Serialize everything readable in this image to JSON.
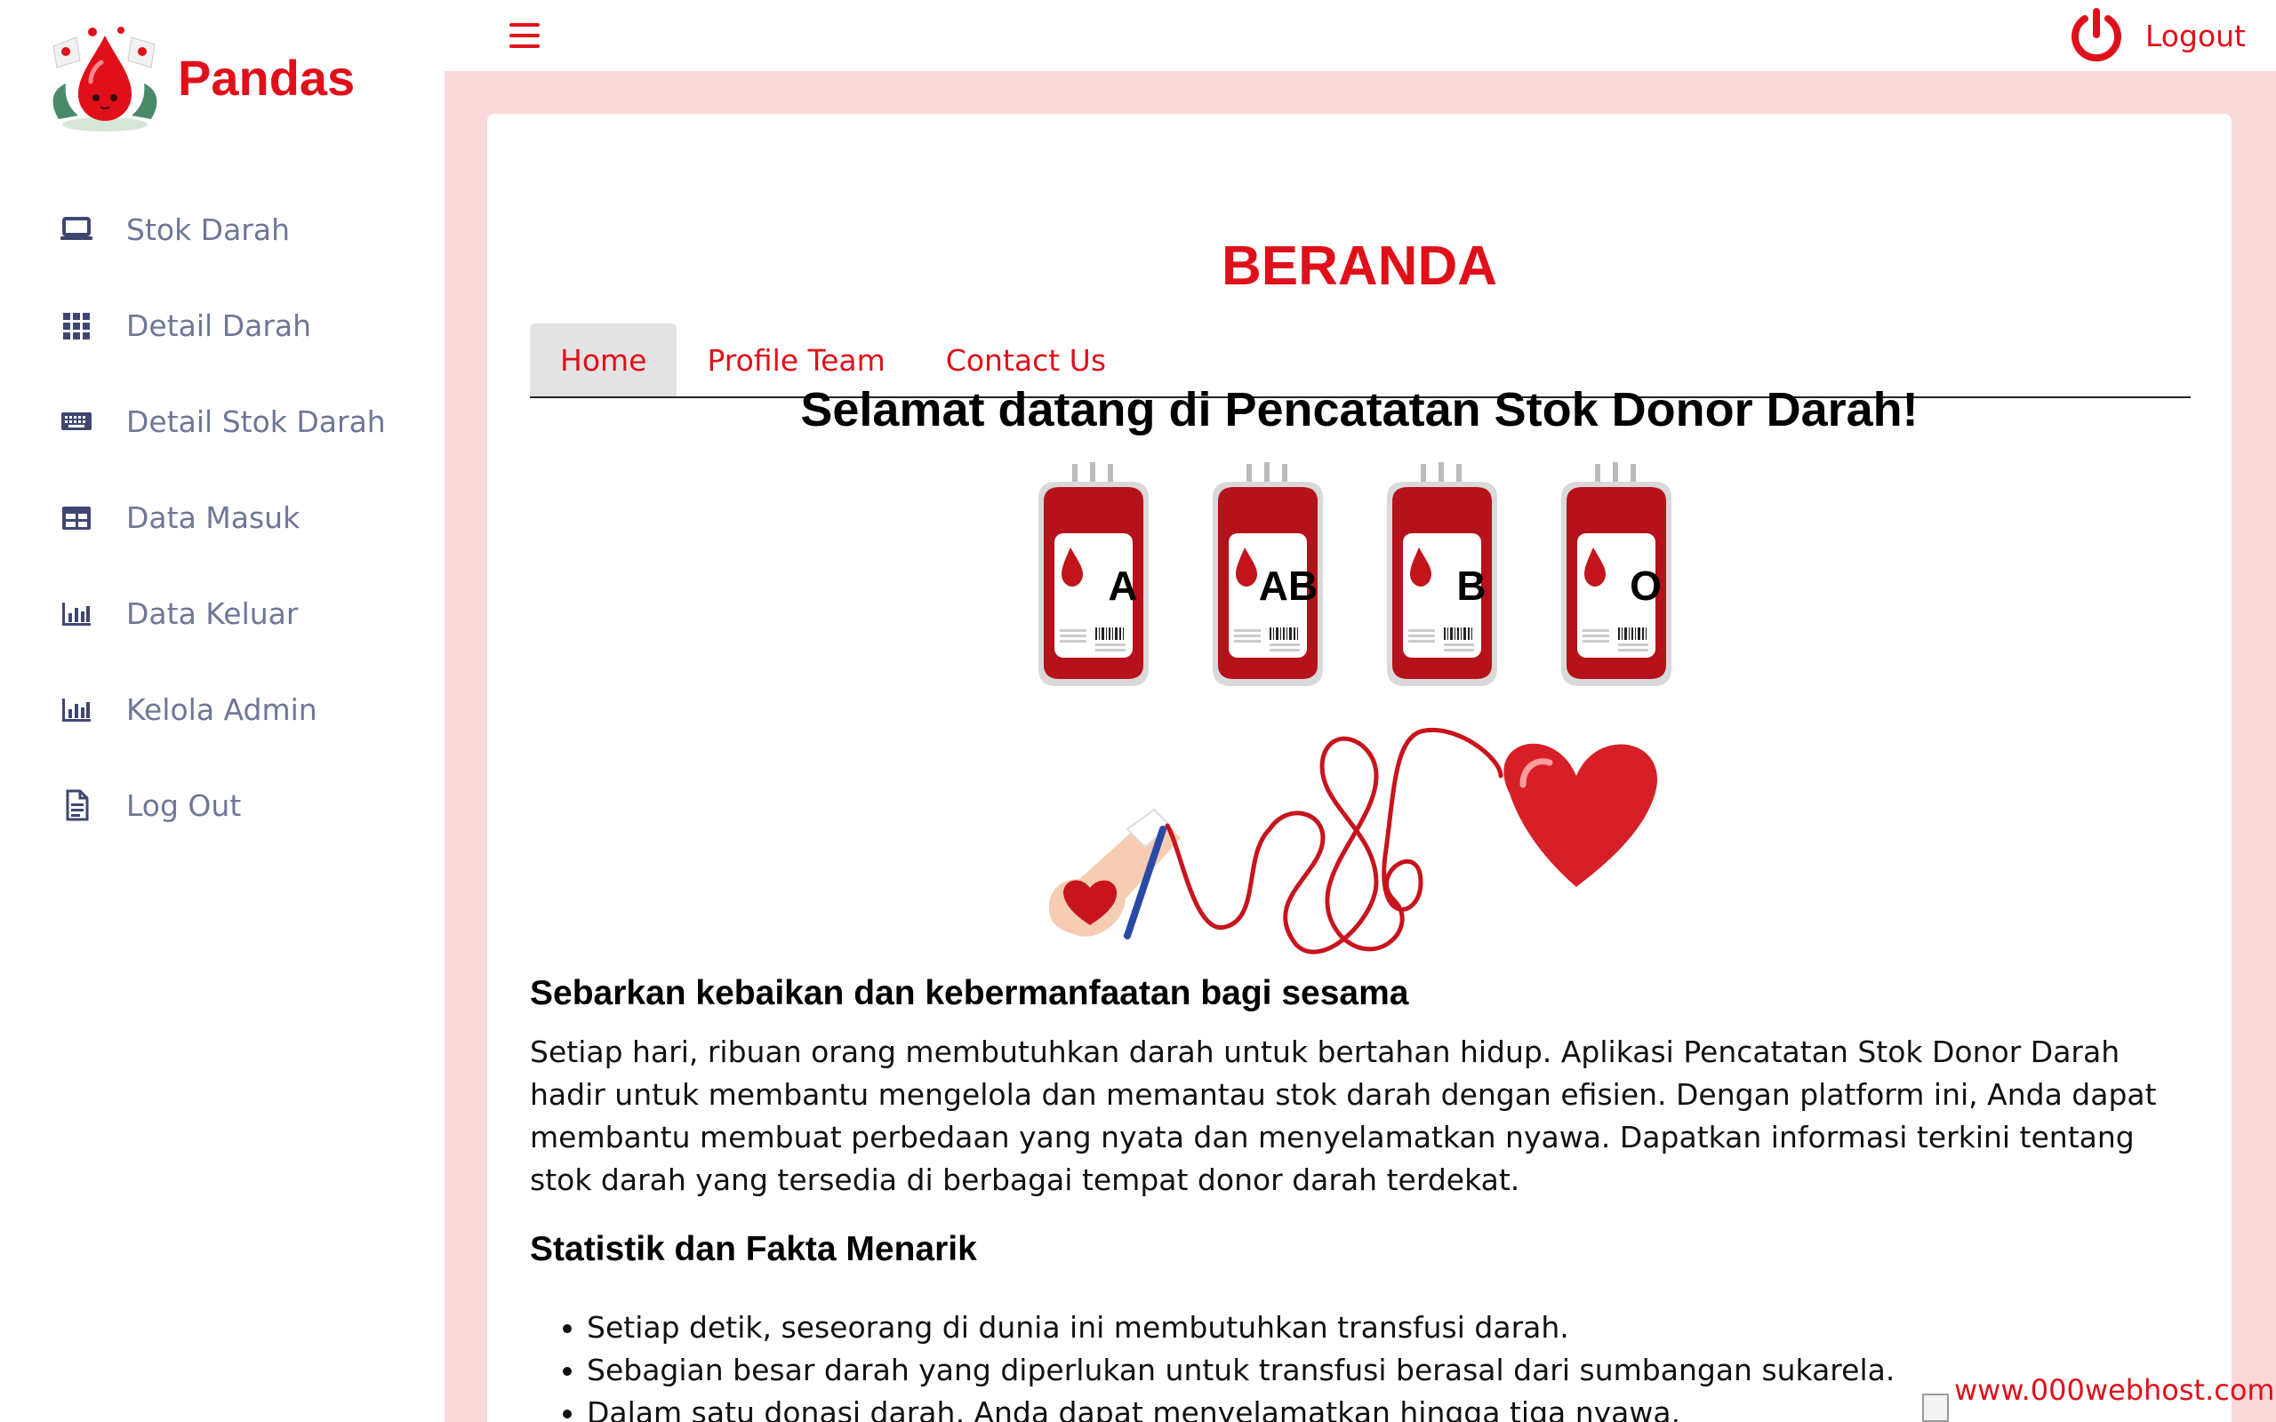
{
  "brand": {
    "name": "Pandas"
  },
  "sidebar": {
    "items": [
      {
        "label": "Stok Darah",
        "icon": "laptop-icon"
      },
      {
        "label": "Detail Darah",
        "icon": "grid-icon"
      },
      {
        "label": "Detail Stok Darah",
        "icon": "keyboard-icon"
      },
      {
        "label": "Data Masuk",
        "icon": "table-icon"
      },
      {
        "label": "Data Keluar",
        "icon": "bar-chart-icon"
      },
      {
        "label": "Kelola Admin",
        "icon": "bar-chart-icon"
      },
      {
        "label": "Log Out",
        "icon": "document-icon"
      }
    ]
  },
  "topbar": {
    "logout_label": "Logout",
    "menu_icon": "hamburger-icon",
    "power_icon": "power-icon"
  },
  "page": {
    "title": "BERANDA",
    "tabs": [
      {
        "label": "Home",
        "active": true
      },
      {
        "label": "Profile Team",
        "active": false
      },
      {
        "label": "Contact Us",
        "active": false
      }
    ],
    "welcome": "Selamat datang di Pencatatan Stok Donor Darah!",
    "blood_types": [
      "A",
      "AB",
      "B",
      "O"
    ],
    "section1": {
      "heading": "Sebarkan kebaikan dan kebermanfaatan bagi sesama",
      "text": "Setiap hari, ribuan orang membutuhkan darah untuk bertahan hidup. Aplikasi Pencatatan Stok Donor Darah hadir untuk membantu mengelola dan memantau stok darah dengan efisien. Dengan platform ini, Anda dapat membantu membuat perbedaan yang nyata dan menyelamatkan nyawa. Dapatkan informasi terkini tentang stok darah yang tersedia di berbagai tempat donor darah terdekat."
    },
    "section2": {
      "heading": "Statistik dan Fakta Menarik",
      "facts": [
        "Setiap detik, seseorang di dunia ini membutuhkan transfusi darah.",
        "Sebagian besar darah yang diperlukan untuk transfusi berasal dari sumbangan sukarela.",
        "Dalam satu donasi darah, Anda dapat menyelamatkan hingga tiga nyawa."
      ]
    }
  },
  "host_badge": "www.000webhost.com",
  "colors": {
    "accent": "#e0101a",
    "content_bg": "#f9d9da",
    "nav_text": "#6e7797"
  }
}
